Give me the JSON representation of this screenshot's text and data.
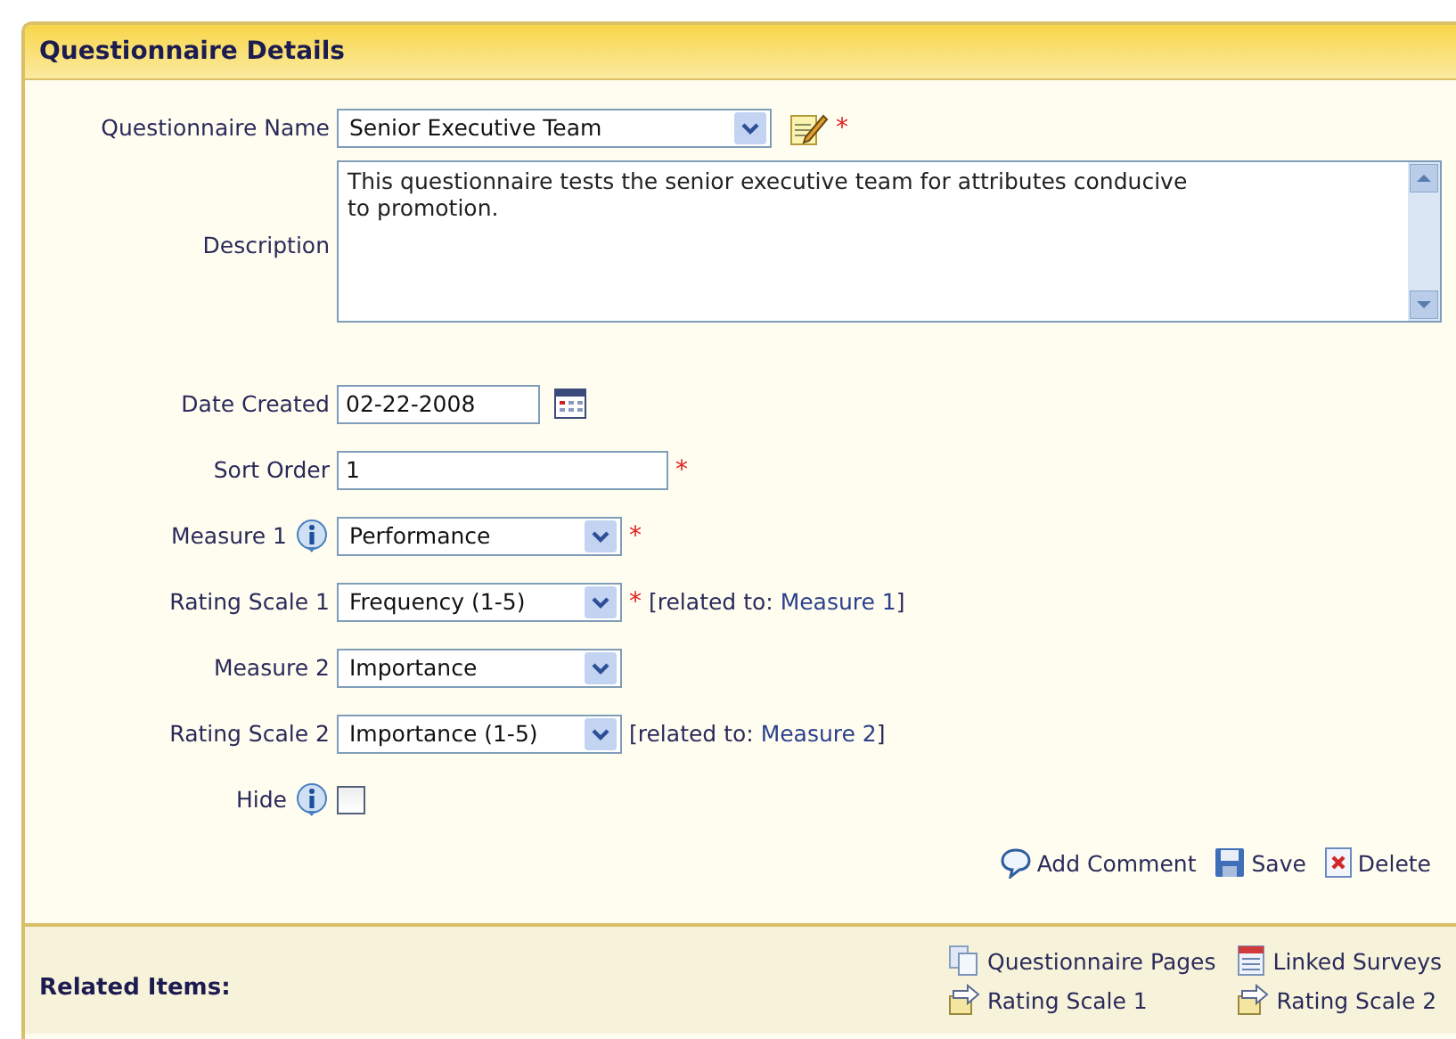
{
  "panel": {
    "title": "Questionnaire Details"
  },
  "fields": [
    {
      "kind": "select",
      "label": "Questionnaire Name",
      "value": "Senior Executive Team",
      "required_mark": "*",
      "edit_icon": true
    },
    {
      "kind": "textarea",
      "label": "Description",
      "value": "This questionnaire tests the senior executive team for attributes conducive to promotion."
    },
    {
      "kind": "date",
      "label": "Date Created",
      "value": "02-22-2008"
    },
    {
      "kind": "text",
      "label": "Sort Order",
      "value": "1",
      "required_mark": "*"
    },
    {
      "kind": "select",
      "label": "Measure 1",
      "value": "Performance",
      "required_mark": "*",
      "info": true
    },
    {
      "kind": "select",
      "label": "Rating Scale 1",
      "value": "Frequency (1-5)",
      "required_mark": "*",
      "related_prefix": "[related to: ",
      "related_link": "Measure 1",
      "related_suffix": "]"
    },
    {
      "kind": "select",
      "label": "Measure 2",
      "value": "Importance"
    },
    {
      "kind": "select",
      "label": "Rating Scale 2",
      "value": "Importance (1-5)",
      "related_prefix": "[related to: ",
      "related_link": "Measure 2",
      "related_suffix": "]"
    },
    {
      "kind": "checkbox",
      "label": "Hide",
      "checked": false,
      "info": true
    }
  ],
  "actions": [
    {
      "kind": "comment",
      "label": "Add Comment"
    },
    {
      "kind": "save",
      "label": "Save"
    },
    {
      "kind": "delete",
      "label": "Delete"
    }
  ],
  "related": {
    "title": "Related Items:",
    "links": [
      {
        "kind": "pages",
        "label": "Questionnaire Pages"
      },
      {
        "kind": "surveys",
        "label": "Linked Surveys"
      },
      {
        "kind": "scale",
        "label": "Rating Scale 1"
      },
      {
        "kind": "scale",
        "label": "Rating Scale 2"
      }
    ]
  }
}
